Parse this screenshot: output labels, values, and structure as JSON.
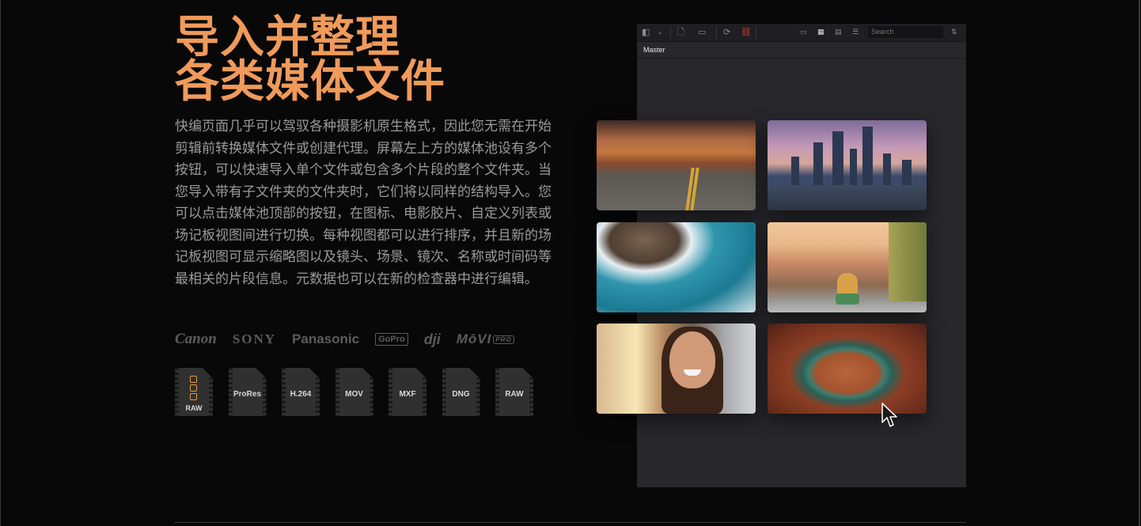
{
  "headline": {
    "line1": "导入并整理",
    "line2": "各类媒体文件"
  },
  "body": "快编页面几乎可以驾驭各种摄影机原生格式，因此您无需在开始剪辑前转换媒体文件或创建代理。屏幕左上方的媒体池设有多个按钮，可以快速导入单个文件或包含多个片段的整个文件夹。当您导入带有子文件夹的文件夹时，它们将以同样的结构导入。您可以点击媒体池顶部的按钮，在图标、电影胶片、自定义列表或场记板视图间进行切换。每种视图都可以进行排序，并且新的场记板视图可显示缩略图以及镜头、场景、镜次、名称或时间码等最相关的片段信息。元数据也可以在新的检查器中进行编辑。",
  "brands": [
    "Canon",
    "SONY",
    "Panasonic",
    "GoPro",
    "dji",
    "MōVI",
    "PRO"
  ],
  "formats": [
    "RAW",
    "ProRes",
    "H.264",
    "MOV",
    "MXF",
    "DNG",
    "RAW"
  ],
  "media_pool": {
    "search_placeholder": "Search",
    "bin_name": "Master",
    "thumbnails": [
      "road-canyon",
      "city-skyline",
      "ocean-coast",
      "verona-view",
      "selfie-street",
      "horseshoe-bend"
    ]
  },
  "colors": {
    "accent": "#f09a5b",
    "body_text": "#9a9a9a",
    "background": "#080808",
    "panel": "#28272c",
    "link_active": "#d9453a"
  }
}
